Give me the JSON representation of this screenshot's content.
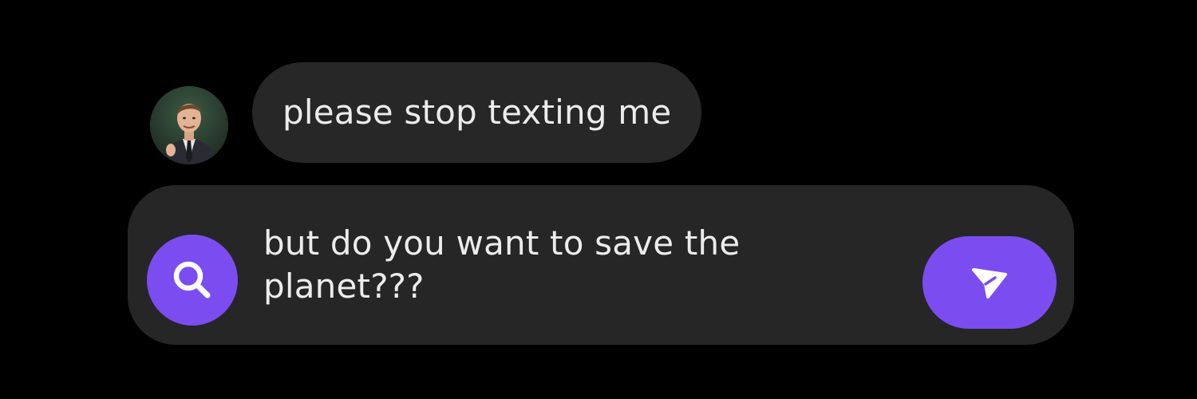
{
  "colors": {
    "background": "#000000",
    "bubble": "#272727",
    "composer": "#262626",
    "accent": "#7b4df0",
    "text": "#ececec"
  },
  "conversation": {
    "incoming_message": {
      "text": "please stop texting me"
    }
  },
  "composer": {
    "text": "but do you want to save the planet???",
    "search_icon": "search-icon",
    "send_icon": "send-icon"
  }
}
